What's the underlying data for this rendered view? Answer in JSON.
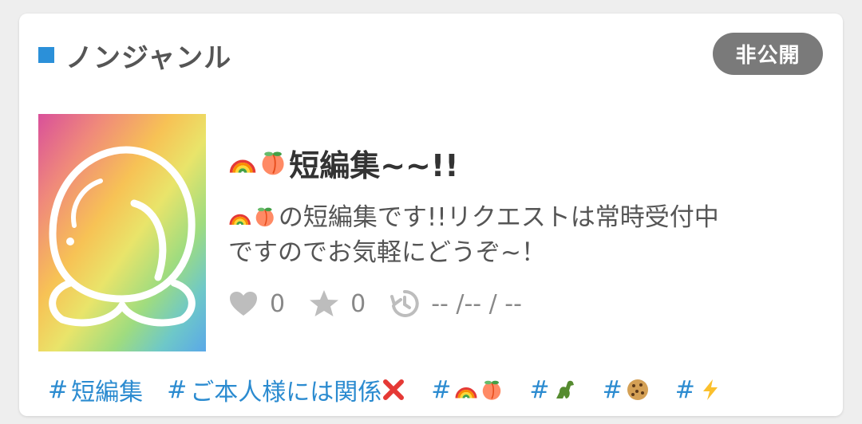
{
  "card": {
    "genre_label": "ノンジャンル",
    "visibility_badge": "非公開",
    "title_text": "短編集~~!!",
    "description_line1": "の短編集です!!リクエストは常時受付中",
    "description_line2": "ですのでお気軽にどうぞ~！",
    "stats": {
      "likes": "0",
      "favorites": "0",
      "updated": "-- /-- / --"
    },
    "tags": [
      {
        "hash": "#",
        "label": "短編集",
        "icons": []
      },
      {
        "hash": "#",
        "label": "ご本人様には関係",
        "icons": [
          "cross-mark-icon"
        ]
      },
      {
        "hash": "#",
        "label": "",
        "icons": [
          "rainbow-icon",
          "peach-icon"
        ]
      },
      {
        "hash": "#",
        "label": "",
        "icons": [
          "dinosaur-icon"
        ]
      },
      {
        "hash": "#",
        "label": "",
        "icons": [
          "cookie-icon"
        ]
      },
      {
        "hash": "#",
        "label": "",
        "icons": [
          "lightning-icon"
        ]
      }
    ]
  },
  "colors": {
    "accent_blue": "#2b90d9",
    "badge_gray": "#7a7a7a",
    "tag_blue": "#2b8bd0",
    "muted_text": "#888888"
  }
}
